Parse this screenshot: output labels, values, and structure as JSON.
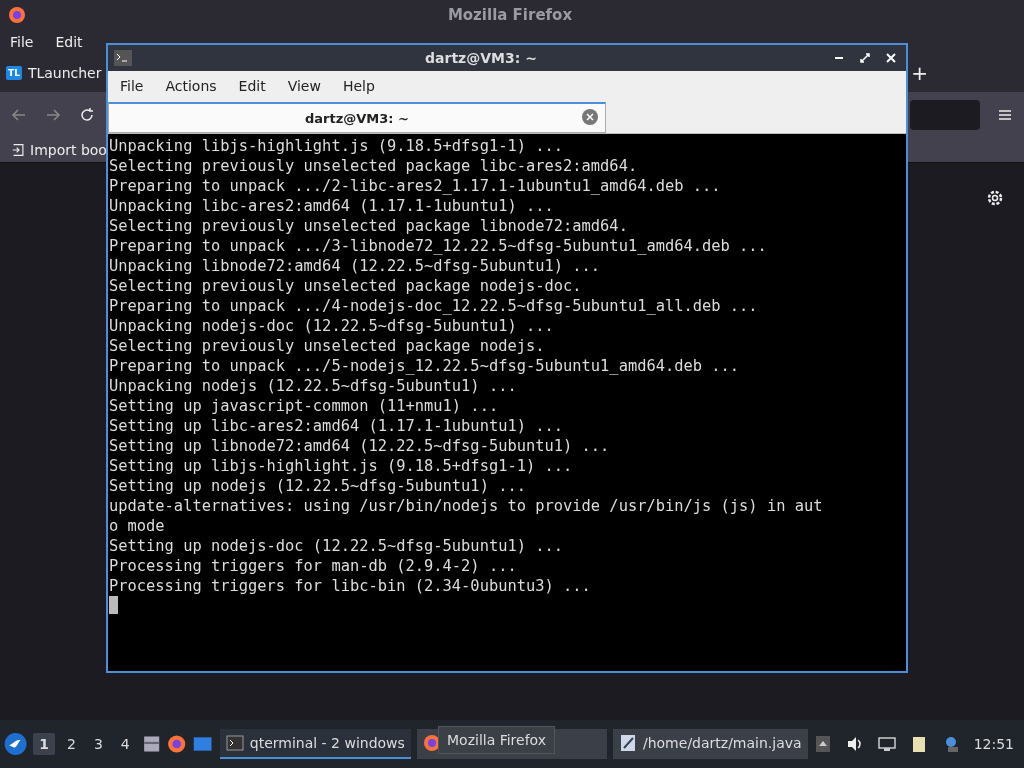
{
  "browser": {
    "title": "Mozilla Firefox",
    "menu": [
      "File",
      "Edit"
    ],
    "tab": {
      "label": "TLauncher",
      "badge": "TL"
    },
    "new_tab": "+",
    "bookmark": "Import boo"
  },
  "terminal": {
    "title": "dartz@VM3: ~",
    "menu": [
      "File",
      "Actions",
      "Edit",
      "View",
      "Help"
    ],
    "tabs": [
      {
        "label": "dartz@VM3: ~",
        "selected": true
      }
    ],
    "lines": [
      "Unpacking libjs-highlight.js (9.18.5+dfsg1-1) ...",
      "Selecting previously unselected package libc-ares2:amd64.",
      "Preparing to unpack .../2-libc-ares2_1.17.1-1ubuntu1_amd64.deb ...",
      "Unpacking libc-ares2:amd64 (1.17.1-1ubuntu1) ...",
      "Selecting previously unselected package libnode72:amd64.",
      "Preparing to unpack .../3-libnode72_12.22.5~dfsg-5ubuntu1_amd64.deb ...",
      "Unpacking libnode72:amd64 (12.22.5~dfsg-5ubuntu1) ...",
      "Selecting previously unselected package nodejs-doc.",
      "Preparing to unpack .../4-nodejs-doc_12.22.5~dfsg-5ubuntu1_all.deb ...",
      "Unpacking nodejs-doc (12.22.5~dfsg-5ubuntu1) ...",
      "Selecting previously unselected package nodejs.",
      "Preparing to unpack .../5-nodejs_12.22.5~dfsg-5ubuntu1_amd64.deb ...",
      "Unpacking nodejs (12.22.5~dfsg-5ubuntu1) ...",
      "Setting up javascript-common (11+nmu1) ...",
      "Setting up libc-ares2:amd64 (1.17.1-1ubuntu1) ...",
      "Setting up libnode72:amd64 (12.22.5~dfsg-5ubuntu1) ...",
      "Setting up libjs-highlight.js (9.18.5+dfsg1-1) ...",
      "Setting up nodejs (12.22.5~dfsg-5ubuntu1) ...",
      "update-alternatives: using /usr/bin/nodejs to provide /usr/bin/js (js) in aut",
      "o mode",
      "Setting up nodejs-doc (12.22.5~dfsg-5ubuntu1) ...",
      "Processing triggers for man-db (2.9.4-2) ...",
      "Processing triggers for libc-bin (2.34-0ubuntu3) ..."
    ]
  },
  "taskbar": {
    "desktops": [
      {
        "label": "1",
        "selected": true
      },
      {
        "label": "2",
        "selected": false
      },
      {
        "label": "3",
        "selected": false
      },
      {
        "label": "4",
        "selected": false
      }
    ],
    "tasks": [
      {
        "kind": "terminal",
        "label": "qterminal - 2 windows",
        "selected": true
      },
      {
        "kind": "firefox",
        "selected": false
      },
      {
        "kind": "editor",
        "label": "/home/dartz/main.java",
        "selected": false
      }
    ],
    "tooltip": "Mozilla Firefox",
    "clock": "12:51"
  }
}
